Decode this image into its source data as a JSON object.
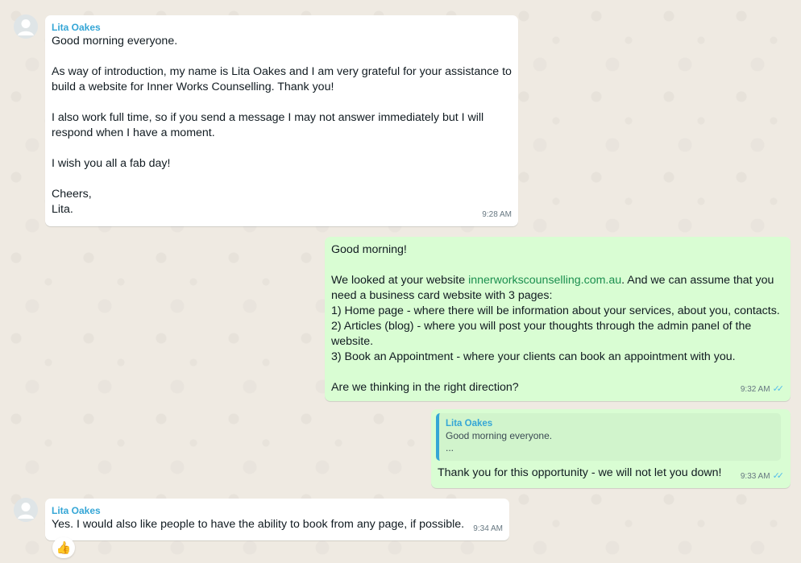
{
  "messages": [
    {
      "sender": "Lita Oakes",
      "lines": [
        "Good morning everyone.",
        "",
        "As way of introduction, my name is Lita Oakes and I am very grateful for your assistance to",
        "build a website for Inner Works Counselling. Thank you!",
        "",
        "I also work full time, so if you send a message I may not answer immediately but I will",
        "respond when I have a moment.",
        "",
        "I wish you all a fab day!",
        "",
        "Cheers,",
        "Lita."
      ],
      "time": "9:28 AM"
    },
    {
      "line0": "Good morning!",
      "line2_pre": "We looked at your website ",
      "line2_link": "innerworkscounselling.com.au",
      "line2_post": ". And we can assume that you",
      "lines_rest": [
        "need a business card website with 3 pages:",
        "1) Home page - where there will be information about your services, about you, contacts.",
        "2) Articles (blog) - where you will post your thoughts through the admin panel of the",
        "website.",
        "3) Book an Appointment - where your clients can book an appointment with you.",
        "",
        "Are we thinking in the right direction?"
      ],
      "time": "9:32 AM"
    },
    {
      "quote_sender": "Lita Oakes",
      "quote_line1": "Good morning everyone.",
      "quote_line2": "...",
      "text": "Thank you for this opportunity - we will not let you down!",
      "time": "9:33 AM"
    },
    {
      "sender": "Lita Oakes",
      "text": "Yes. I would also like people to have the ability to book from any page, if possible.",
      "time": "9:34 AM",
      "reaction": "👍"
    }
  ],
  "colors": {
    "background": "#efeae2",
    "incoming": "#ffffff",
    "outgoing": "#d9fdd3",
    "sender_name": "#35a6d6",
    "read_ticks": "#53bdeb"
  },
  "icons": {
    "avatar": "default-person-avatar-icon",
    "read_status": "double-check-icon"
  }
}
